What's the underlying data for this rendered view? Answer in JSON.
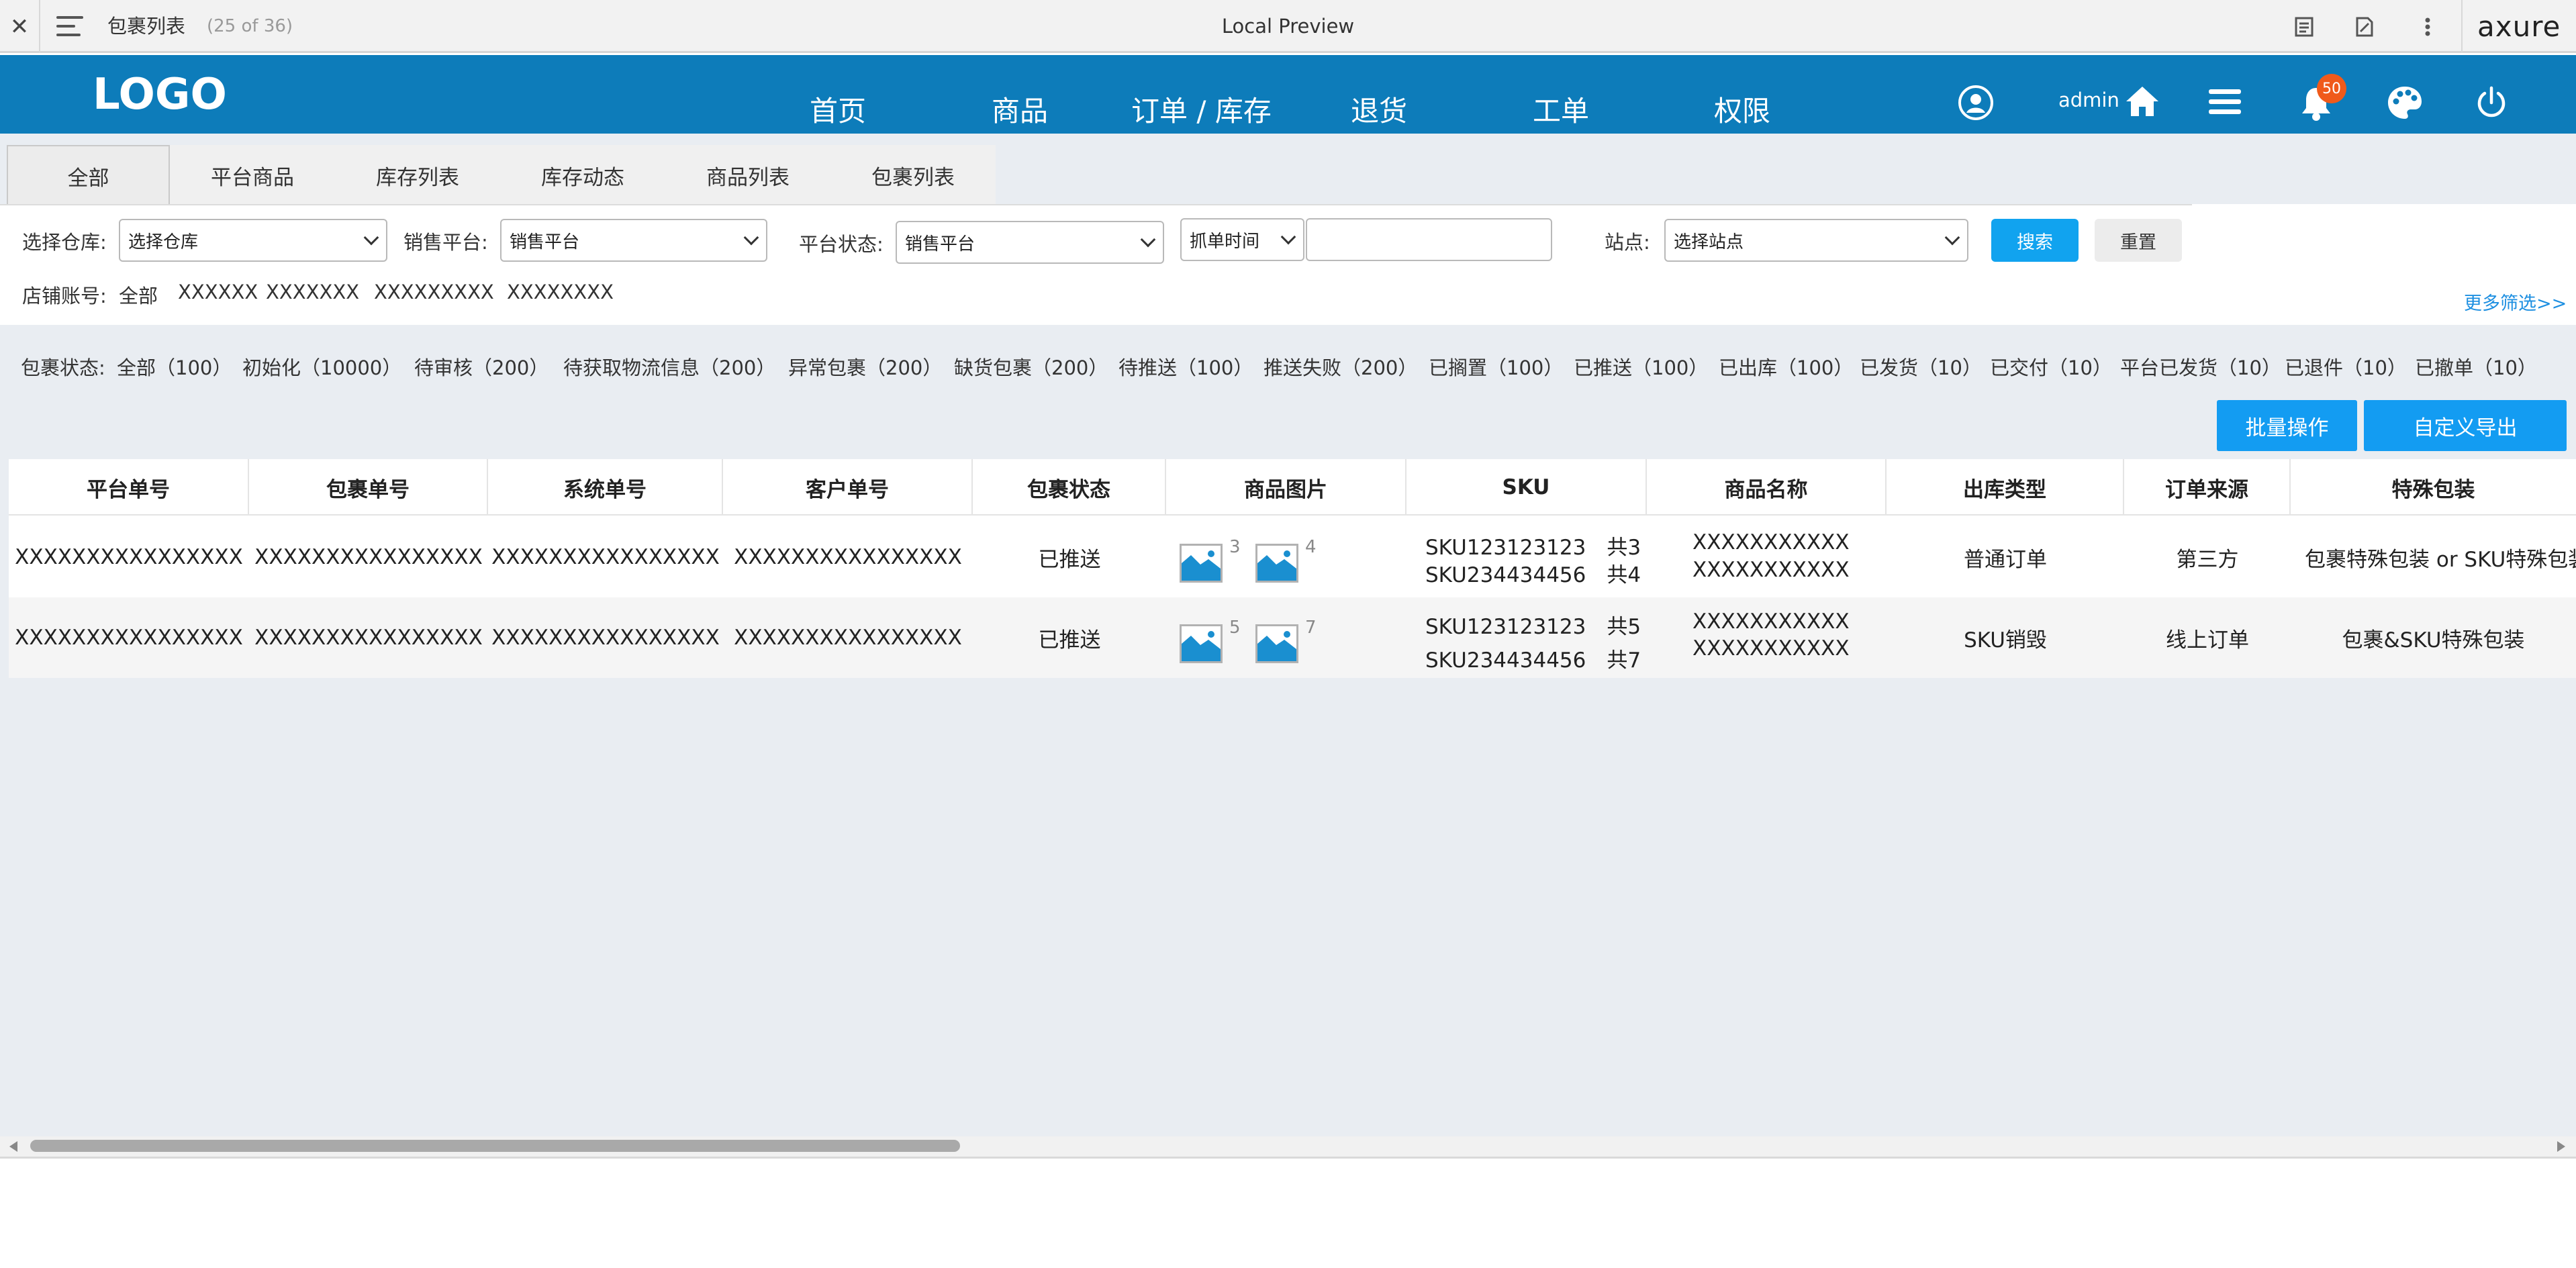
{
  "viewer": {
    "page_title": "包裹列表",
    "page_count": "(25 of 36)",
    "center_title": "Local Preview",
    "brand": "axure"
  },
  "header": {
    "logo": "LOGO",
    "nav": [
      "首页",
      "商品",
      "订单 / 库存",
      "退货",
      "工单",
      "权限"
    ],
    "user": "admin",
    "notification_count": "50"
  },
  "tabs": [
    "全部",
    "平台商品",
    "库存列表",
    "库存动态",
    "商品列表",
    "包裹列表"
  ],
  "filters": {
    "warehouse_label": "选择仓库:",
    "warehouse_value": "选择仓库",
    "platform_label": "销售平台:",
    "platform_value": "销售平台",
    "platform_status_label": "平台状态:",
    "platform_status_value": "销售平台",
    "time_value": "抓单时间",
    "site_label": "站点:",
    "site_value": "选择站点",
    "search_button": "搜索",
    "reset_button": "重置",
    "account_label": "店铺账号:",
    "accounts": [
      "全部",
      "XXXXXX",
      "XXXXXXX",
      "XXXXXXXXX",
      "XXXXXXXX"
    ],
    "more_link": "更多筛选>>"
  },
  "status_bar": {
    "label": "包裹状态:",
    "items": [
      "全部（100）",
      "初始化（10000）",
      "待审核（200）",
      "待获取物流信息（200）",
      "异常包裹（200）",
      "缺货包裹（200）",
      "待推送（100）",
      "推送失败（200）",
      "已搁置（100）",
      "已推送（100）",
      "已出库（100）",
      "已发货（10）",
      "已交付（10）",
      "平台已发货（10）",
      "已退件（10）",
      "已撤单（10）"
    ]
  },
  "actions": {
    "batch": "批量操作",
    "export": "自定义导出"
  },
  "table": {
    "headers": [
      "平台单号",
      "包裹单号",
      "系统单号",
      "客户单号",
      "包裹状态",
      "商品图片",
      "SKU",
      "商品名称",
      "出库类型",
      "订单来源",
      "特殊包装"
    ],
    "rows": [
      {
        "platform_no": "XXXXXXXXXXXXXXXX",
        "package_no": "XXXXXXXXXXXXXXXX",
        "system_no": "XXXXXXXXXXXXXXXX",
        "customer_no": "XXXXXXXXXXXXXXXX",
        "status": "已推送",
        "img_counts": [
          "3",
          "4"
        ],
        "sku_lines": [
          "SKU123123123　共3",
          "SKU234434456　共4"
        ],
        "name_lines": [
          "XXXXXXXXXXX",
          "XXXXXXXXXXX"
        ],
        "outbound_type": "普通订单",
        "source": "第三方",
        "special": "包裹特殊包装 or SKU特殊包装"
      },
      {
        "platform_no": "XXXXXXXXXXXXXXXX",
        "package_no": "XXXXXXXXXXXXXXXX",
        "system_no": "XXXXXXXXXXXXXXXX",
        "customer_no": "XXXXXXXXXXXXXXXX",
        "status": "已推送",
        "img_counts": [
          "5",
          "7"
        ],
        "sku_lines": [
          "SKU123123123　共5",
          "SKU234434456　共7"
        ],
        "name_lines": [
          "XXXXXXXXXXX",
          "XXXXXXXXXXX"
        ],
        "outbound_type": "SKU销毁",
        "source": "线上订单",
        "special": "包裹&SKU特殊包装"
      }
    ]
  },
  "colors": {
    "header_blue": "#0d7cba",
    "button_blue": "#139cf2",
    "badge_orange": "#f05a1a",
    "content_bg": "#e9edf2"
  },
  "icons": [
    "close-icon",
    "menu-icon",
    "notes-icon",
    "export-icon",
    "more-vertical-icon",
    "user-icon",
    "home-icon",
    "list-icon",
    "bell-icon",
    "palette-icon",
    "power-icon",
    "image-icon"
  ]
}
